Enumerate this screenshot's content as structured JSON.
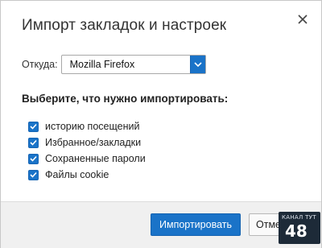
{
  "dialog": {
    "title": "Импорт закладок и настроек",
    "source_label": "Откуда:",
    "source_value": "Mozilla Firefox",
    "section_heading": "Выберите, что нужно импортировать:",
    "options": [
      {
        "label": "историю посещений",
        "checked": true
      },
      {
        "label": "Избранное/закладки",
        "checked": true
      },
      {
        "label": "Сохраненные пароли",
        "checked": true
      },
      {
        "label": "Файлы cookie",
        "checked": true
      }
    ],
    "import_button": "Импортировать",
    "cancel_button": "Отмена"
  },
  "watermark": {
    "text": "КАНАЛ ТУТ",
    "number": "48"
  },
  "colors": {
    "accent": "#1a73c8",
    "footer_bg": "#f0f0f0"
  }
}
